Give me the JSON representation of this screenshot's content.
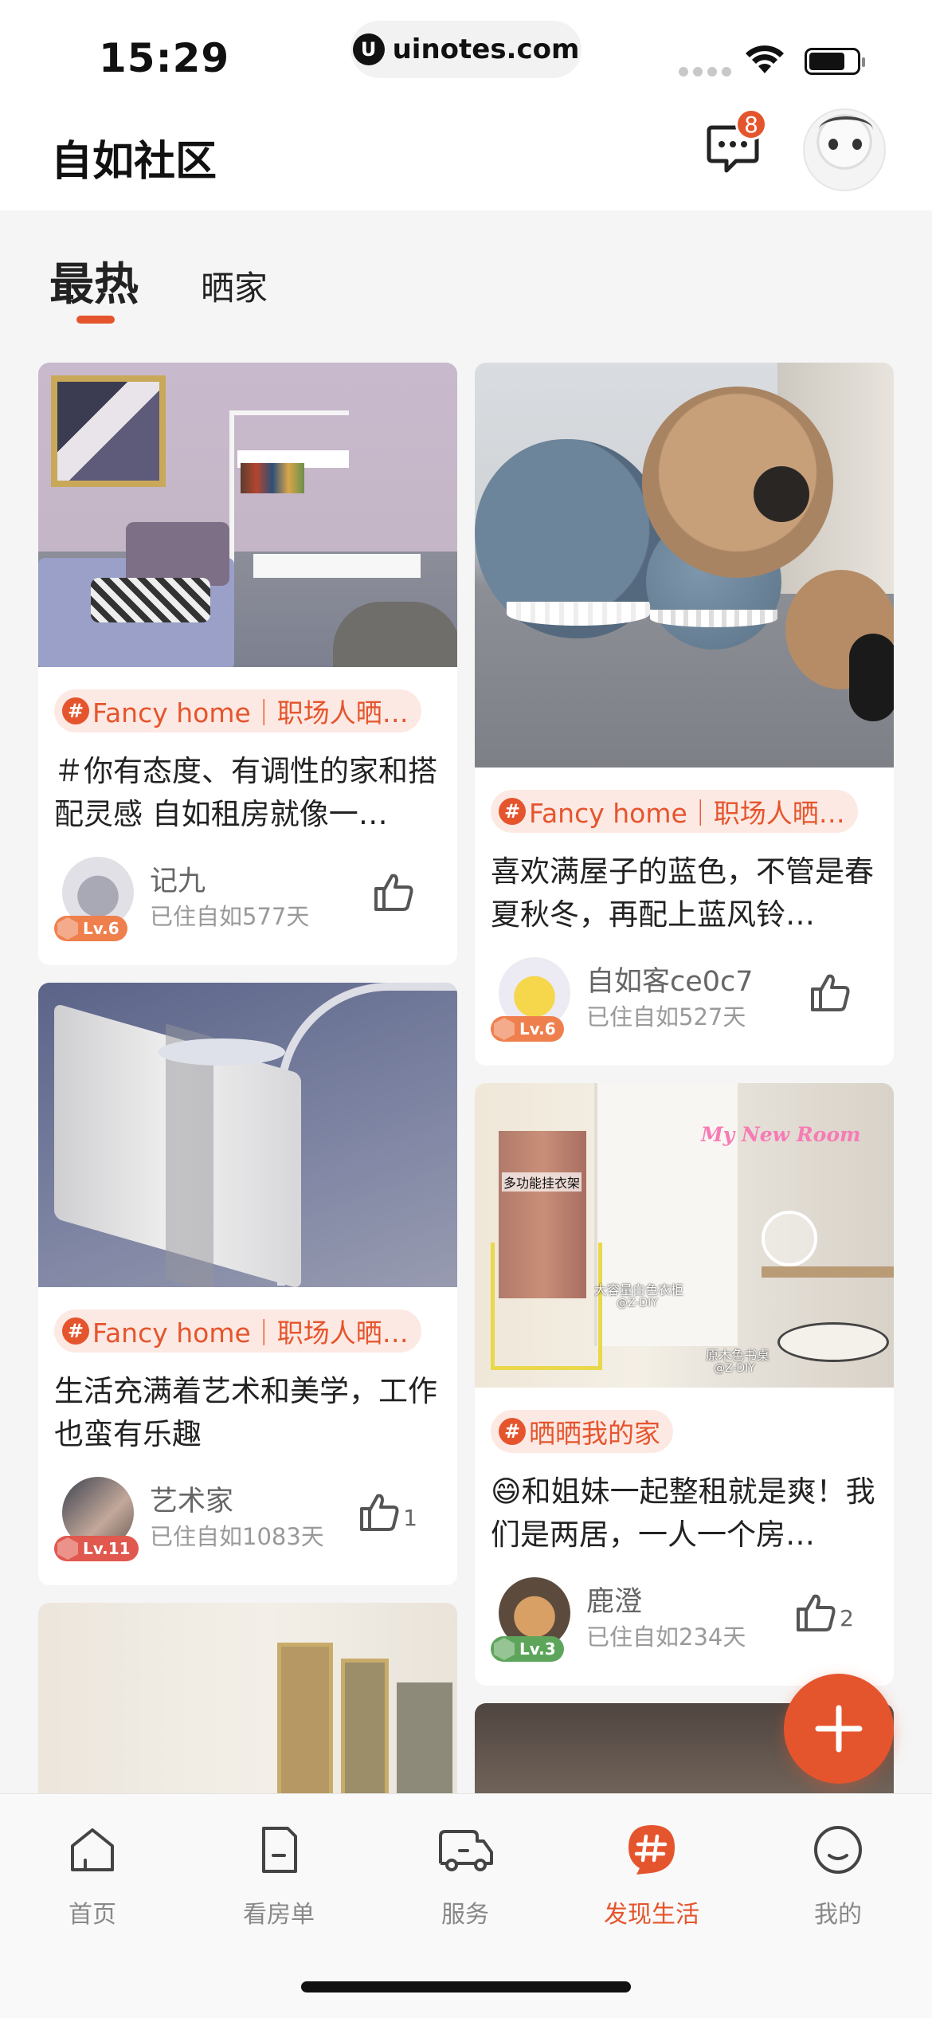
{
  "status_bar": {
    "time": "15:29",
    "url": "uinotes.com",
    "url_icon_letter": "U"
  },
  "header": {
    "title": "自如社区",
    "message_badge": "8",
    "icons": [
      "message-icon",
      "avatar"
    ]
  },
  "tabs": [
    {
      "label": "最热",
      "active": true
    },
    {
      "label": "晒家",
      "active": false
    }
  ],
  "hash_symbol": "#",
  "feed": {
    "left": [
      {
        "topic": "Fancy home｜职场人晒…",
        "text": "＃你有态度、有调性的家和搭配灵感 自如租房就像一…",
        "author": "记九",
        "days": "已住自如577天",
        "level": "Lv.6",
        "likes": ""
      },
      {
        "topic": "Fancy home｜职场人晒…",
        "text": "生活充满着艺术和美学，工作也蛮有乐趣",
        "author": "艺术家",
        "days": "已住自如1083天",
        "level": "Lv.11",
        "likes": "1"
      }
    ],
    "right": [
      {
        "topic": "Fancy home｜职场人晒…",
        "text": "喜欢满屋子的蓝色，不管是春夏秋冬，再配上蓝风铃…",
        "author": "自如客ce0c7",
        "days": "已住自如527天",
        "level": "Lv.6",
        "likes": ""
      },
      {
        "topic": "晒晒我的家",
        "text": "😄和姐妹一起整租就是爽！我们是两居，一人一个房…",
        "author": "鹿澄",
        "days": "已住自如234天",
        "level": "Lv.3",
        "likes": "2",
        "image_labels": {
          "title": "My New Room",
          "rack": "多功能挂衣架",
          "wardrobe": "大容量白色衣柜",
          "wardrobe_credit": "@Z-DIY",
          "desk": "原木色书桌",
          "desk_credit": "@Z-DIY"
        }
      }
    ]
  },
  "fab": {
    "icon": "plus-icon"
  },
  "tabbar": [
    {
      "label": "首页",
      "icon": "home-icon",
      "active": false
    },
    {
      "label": "看房单",
      "icon": "document-icon",
      "active": false
    },
    {
      "label": "服务",
      "icon": "truck-icon",
      "active": false
    },
    {
      "label": "发现生活",
      "icon": "hashtag-icon",
      "active": true
    },
    {
      "label": "我的",
      "icon": "smile-icon",
      "active": false
    }
  ],
  "colors": {
    "accent": "#e5552d",
    "topic_bg": "#fde9e3",
    "level_orange": "#ef7f4d",
    "level_red": "#e0584e",
    "level_green": "#5ea55c"
  }
}
